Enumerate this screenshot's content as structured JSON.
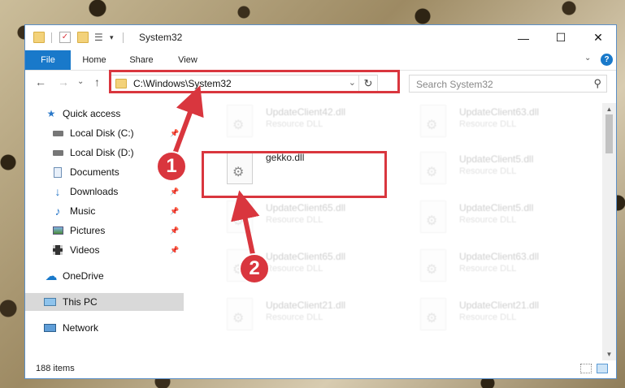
{
  "window": {
    "title": "System32",
    "controls": {
      "minimize": "—",
      "maximize": "☐",
      "close": "✕"
    }
  },
  "ribbon": {
    "tabs": [
      "File",
      "Home",
      "Share",
      "View"
    ],
    "expand_icon": "chevron-down-icon",
    "help_label": "?"
  },
  "navigation": {
    "back": "←",
    "forward": "→",
    "recent": "⌄",
    "up": "↑",
    "address": "C:\\Windows\\System32",
    "refresh": "↻",
    "search_placeholder": "Search System32"
  },
  "sidebar": {
    "items": [
      {
        "label": "Quick access",
        "icon": "star-icon",
        "pinned": false
      },
      {
        "label": "Local Disk (C:)",
        "icon": "drive-icon",
        "pinned": true
      },
      {
        "label": "Local Disk (D:)",
        "icon": "drive-icon",
        "pinned": true
      },
      {
        "label": "Documents",
        "icon": "document-icon",
        "pinned": true
      },
      {
        "label": "Downloads",
        "icon": "download-icon",
        "pinned": true
      },
      {
        "label": "Music",
        "icon": "music-icon",
        "pinned": true
      },
      {
        "label": "Pictures",
        "icon": "pictures-icon",
        "pinned": true
      },
      {
        "label": "Videos",
        "icon": "videos-icon",
        "pinned": true
      },
      {
        "label": "OneDrive",
        "icon": "cloud-icon",
        "pinned": false
      },
      {
        "label": "This PC",
        "icon": "computer-icon",
        "pinned": false,
        "selected": true
      },
      {
        "label": "Network",
        "icon": "network-icon",
        "pinned": false
      }
    ]
  },
  "files": {
    "highlighted": {
      "name": "gekko.dll"
    },
    "faded": [
      {
        "name": "UpdateClient42.dll",
        "type": "Resource DLL"
      },
      {
        "name": "UpdateClient63.dll",
        "type": "Resource DLL"
      },
      {
        "name": "UpdateClient5.dll",
        "type": "Resource DLL"
      },
      {
        "name": "UpdateClient65.dll",
        "type": "Resource DLL"
      },
      {
        "name": "UpdateClient5.dll",
        "type": "Resource DLL"
      },
      {
        "name": "UpdateClient65.dll",
        "type": "Resource DLL"
      },
      {
        "name": "UpdateClient63.dll",
        "type": "Resource DLL"
      },
      {
        "name": "UpdateClient21.dll",
        "type": "Resource DLL"
      },
      {
        "name": "UpdateClient21.dll",
        "type": "Resource DLL"
      }
    ]
  },
  "status": {
    "item_count": "188 items"
  },
  "annotations": {
    "step1": "1",
    "step2": "2",
    "color": "#d9363e"
  }
}
